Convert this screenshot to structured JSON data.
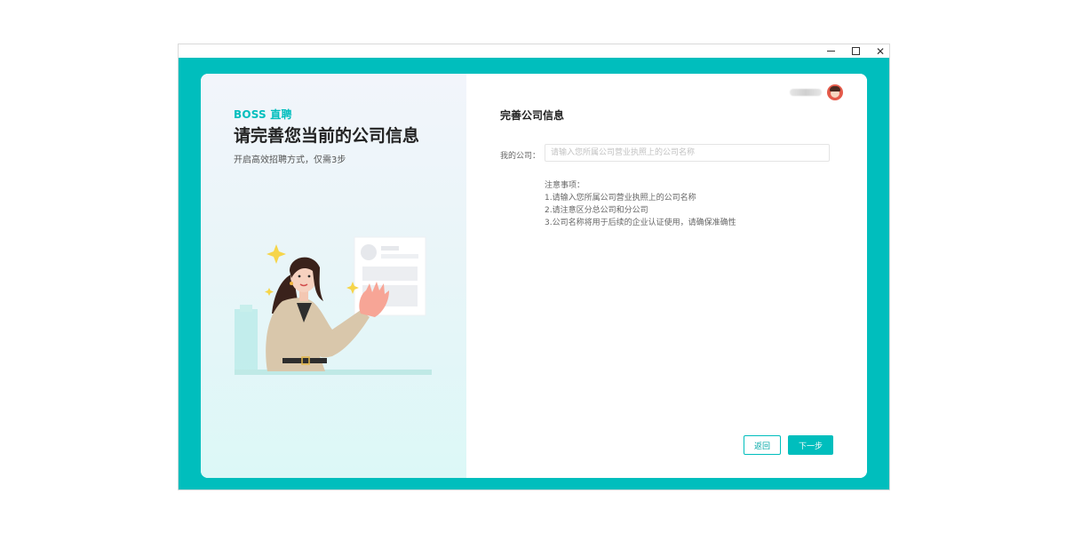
{
  "window": {
    "controls": {
      "minimize_icon": "minimize-icon",
      "maximize_icon": "maximize-icon",
      "close_icon": "close-icon",
      "close_glyph": "✕"
    }
  },
  "left": {
    "brand": "BOSS 直聘",
    "title": "请完善您当前的公司信息",
    "subtitle": "开启高效招聘方式，仅需3步"
  },
  "header": {
    "avatar_icon": "avatar"
  },
  "form": {
    "title": "完善公司信息",
    "company_label": "我的公司：",
    "company_value": "",
    "company_placeholder": "请输入您所属公司营业执照上的公司名称",
    "notes_title": "注意事项：",
    "notes": [
      "1.请输入您所属公司营业执照上的公司名称",
      "2.请注意区分总公司和分公司",
      "3.公司名称将用于后续的企业认证使用，请确保准确性"
    ],
    "back_label": "返回",
    "next_label": "下一步"
  },
  "colors": {
    "accent": "#00bebd",
    "left_bg_top": "#f2f5fb",
    "left_bg_bottom": "#dcf8f7"
  }
}
